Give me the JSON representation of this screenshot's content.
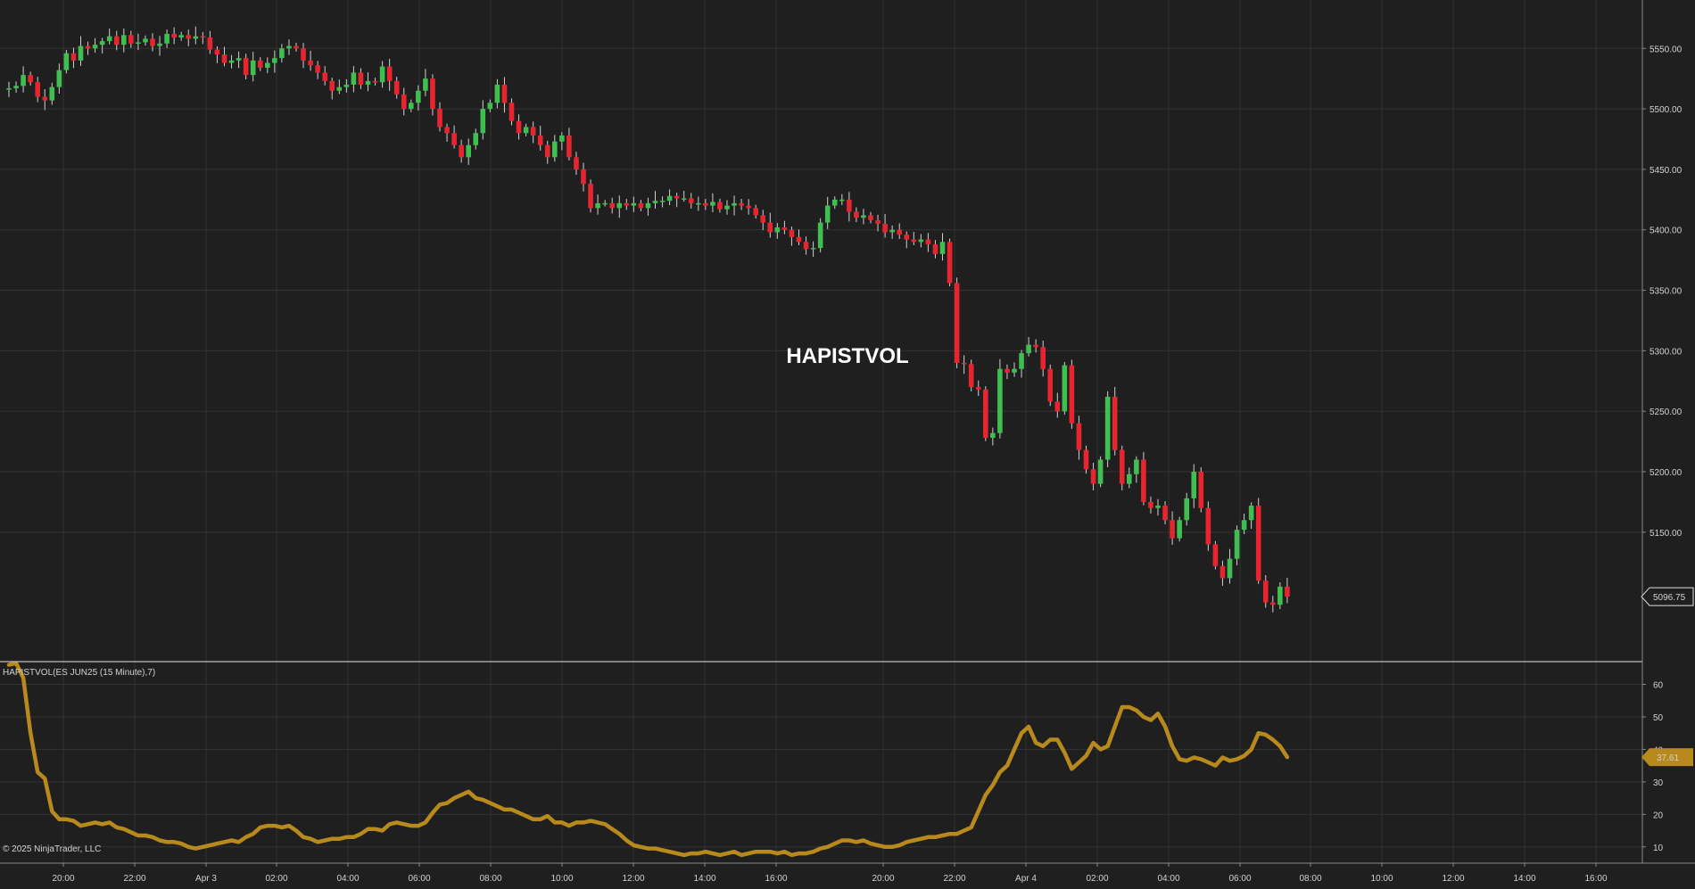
{
  "chart_title": "HAPISTVOL",
  "indicator_label": "HAPISTVOL(ES JUN25 (15 Minute),7)",
  "copyright": "© 2025 NinjaTrader, LLC",
  "colors": {
    "background": "#1f1f1f",
    "grid": "#333333",
    "up_candle": "#3fbf4f",
    "down_candle": "#e8252f",
    "wick": "#d0d0d0",
    "indicator_line": "#b8891c",
    "price_tag": "#1f1f1f",
    "indicator_tag": "#b8891c"
  },
  "chart_data": [
    {
      "type": "candlestick",
      "title": "HAPISTVOL",
      "x_ticks": [
        "20:00",
        "22:00",
        "Apr 3",
        "02:00",
        "04:00",
        "06:00",
        "08:00",
        "10:00",
        "12:00",
        "14:00",
        "16:00",
        "20:00",
        "22:00",
        "Apr 4",
        "02:00",
        "04:00",
        "06:00",
        "08:00",
        "10:00",
        "12:00",
        "14:00",
        "16:00"
      ],
      "y_ticks": [
        "5550.00",
        "5500.00",
        "5450.00",
        "5400.00",
        "5350.00",
        "5300.00",
        "5250.00",
        "5200.00",
        "5150.00"
      ],
      "y_tick_values": [
        5550,
        5500,
        5450,
        5400,
        5350,
        5300,
        5250,
        5200,
        5150
      ],
      "ylim": [
        5043,
        5590
      ],
      "last_price": "5096.75",
      "grid": true,
      "close_values": [
        5517,
        5519,
        5528,
        5522,
        5510,
        5507,
        5518,
        5532,
        5546,
        5540,
        5552,
        5550,
        5553,
        5556,
        5560,
        5553,
        5561,
        5554,
        5555,
        5558,
        5552,
        5554,
        5562,
        5559,
        5561,
        5558,
        5560,
        5559,
        5549,
        5545,
        5538,
        5540,
        5542,
        5528,
        5540,
        5534,
        5538,
        5542,
        5550,
        5552,
        5550,
        5540,
        5536,
        5530,
        5523,
        5515,
        5518,
        5520,
        5530,
        5520,
        5523,
        5522,
        5535,
        5523,
        5512,
        5500,
        5505,
        5515,
        5525,
        5500,
        5485,
        5480,
        5470,
        5460,
        5470,
        5480,
        5500,
        5505,
        5520,
        5505,
        5490,
        5480,
        5485,
        5478,
        5470,
        5460,
        5473,
        5478,
        5460,
        5450,
        5438,
        5418,
        5422,
        5422,
        5418,
        5422,
        5420,
        5422,
        5418,
        5422,
        5424,
        5424,
        5428,
        5426,
        5426,
        5422,
        5422,
        5420,
        5423,
        5417,
        5420,
        5422,
        5420,
        5418,
        5412,
        5406,
        5398,
        5402,
        5400,
        5394,
        5390,
        5384,
        5385,
        5406,
        5420,
        5425,
        5425,
        5415,
        5410,
        5412,
        5408,
        5405,
        5398,
        5400,
        5396,
        5392,
        5390,
        5392,
        5388,
        5380,
        5390,
        5356,
        5290,
        5289,
        5270,
        5268,
        5228,
        5232,
        5285,
        5282,
        5285,
        5298,
        5305,
        5303,
        5285,
        5258,
        5250,
        5288,
        5240,
        5218,
        5202,
        5190,
        5210,
        5262,
        5218,
        5190,
        5198,
        5210,
        5175,
        5170,
        5172,
        5160,
        5145,
        5160,
        5178,
        5200,
        5170,
        5140,
        5122,
        5112,
        5128,
        5152,
        5160,
        5172,
        5110,
        5092,
        5090,
        5105,
        5096.75
      ]
    },
    {
      "type": "line",
      "title": "HAPISTVOL(ES JUN25 (15 Minute),7)",
      "y_ticks": [
        "60",
        "50",
        "40",
        "30",
        "20",
        "10"
      ],
      "y_tick_values": [
        60,
        50,
        40,
        30,
        20,
        10
      ],
      "ylim": [
        5,
        67
      ],
      "last_value": "37.61",
      "grid": true,
      "values": [
        66,
        66.5,
        62,
        45,
        33,
        31,
        21,
        18.5,
        18.5,
        18,
        16.5,
        17,
        17.5,
        17,
        17.5,
        16,
        15.5,
        14.5,
        13.5,
        13.5,
        13,
        12,
        11.5,
        11.5,
        11,
        10,
        9.5,
        10,
        10.5,
        11,
        11.5,
        12,
        11.5,
        13,
        14,
        16,
        16.5,
        16.5,
        16,
        16.5,
        15,
        13,
        12.5,
        11.5,
        12,
        12.5,
        12.5,
        13,
        13,
        14,
        15.5,
        15.5,
        15,
        17,
        17.5,
        17,
        16.5,
        16.5,
        17.5,
        20.5,
        23,
        23.5,
        25,
        26,
        27,
        25,
        24.5,
        23.5,
        22.5,
        21.5,
        21.5,
        20.5,
        19.5,
        18.5,
        18.5,
        19.5,
        17.5,
        17.5,
        16.5,
        17.5,
        17.5,
        18,
        17.5,
        17,
        15.5,
        14,
        12,
        10.5,
        10,
        9.5,
        9.5,
        9,
        8.5,
        8,
        7.5,
        8,
        8,
        8.5,
        8,
        7.5,
        8,
        8.5,
        7.5,
        8,
        8.5,
        8.5,
        8.5,
        8,
        8.5,
        7.5,
        8,
        8,
        8.5,
        9.5,
        10,
        11,
        12,
        12,
        11.5,
        12,
        11,
        10.5,
        10,
        10,
        10.5,
        11.5,
        12,
        12.5,
        13,
        13,
        13.5,
        14,
        14,
        15,
        16,
        21,
        26,
        29,
        33,
        35,
        40,
        45,
        47,
        42,
        41,
        43,
        43,
        39,
        34,
        36,
        38,
        42,
        40,
        41,
        47,
        53,
        53,
        52,
        50,
        49,
        51,
        47,
        41,
        37,
        36.5,
        37.5,
        37,
        36,
        35,
        37.5,
        36.5,
        37,
        38,
        40,
        45,
        44.5,
        43,
        41,
        37.61
      ]
    }
  ]
}
